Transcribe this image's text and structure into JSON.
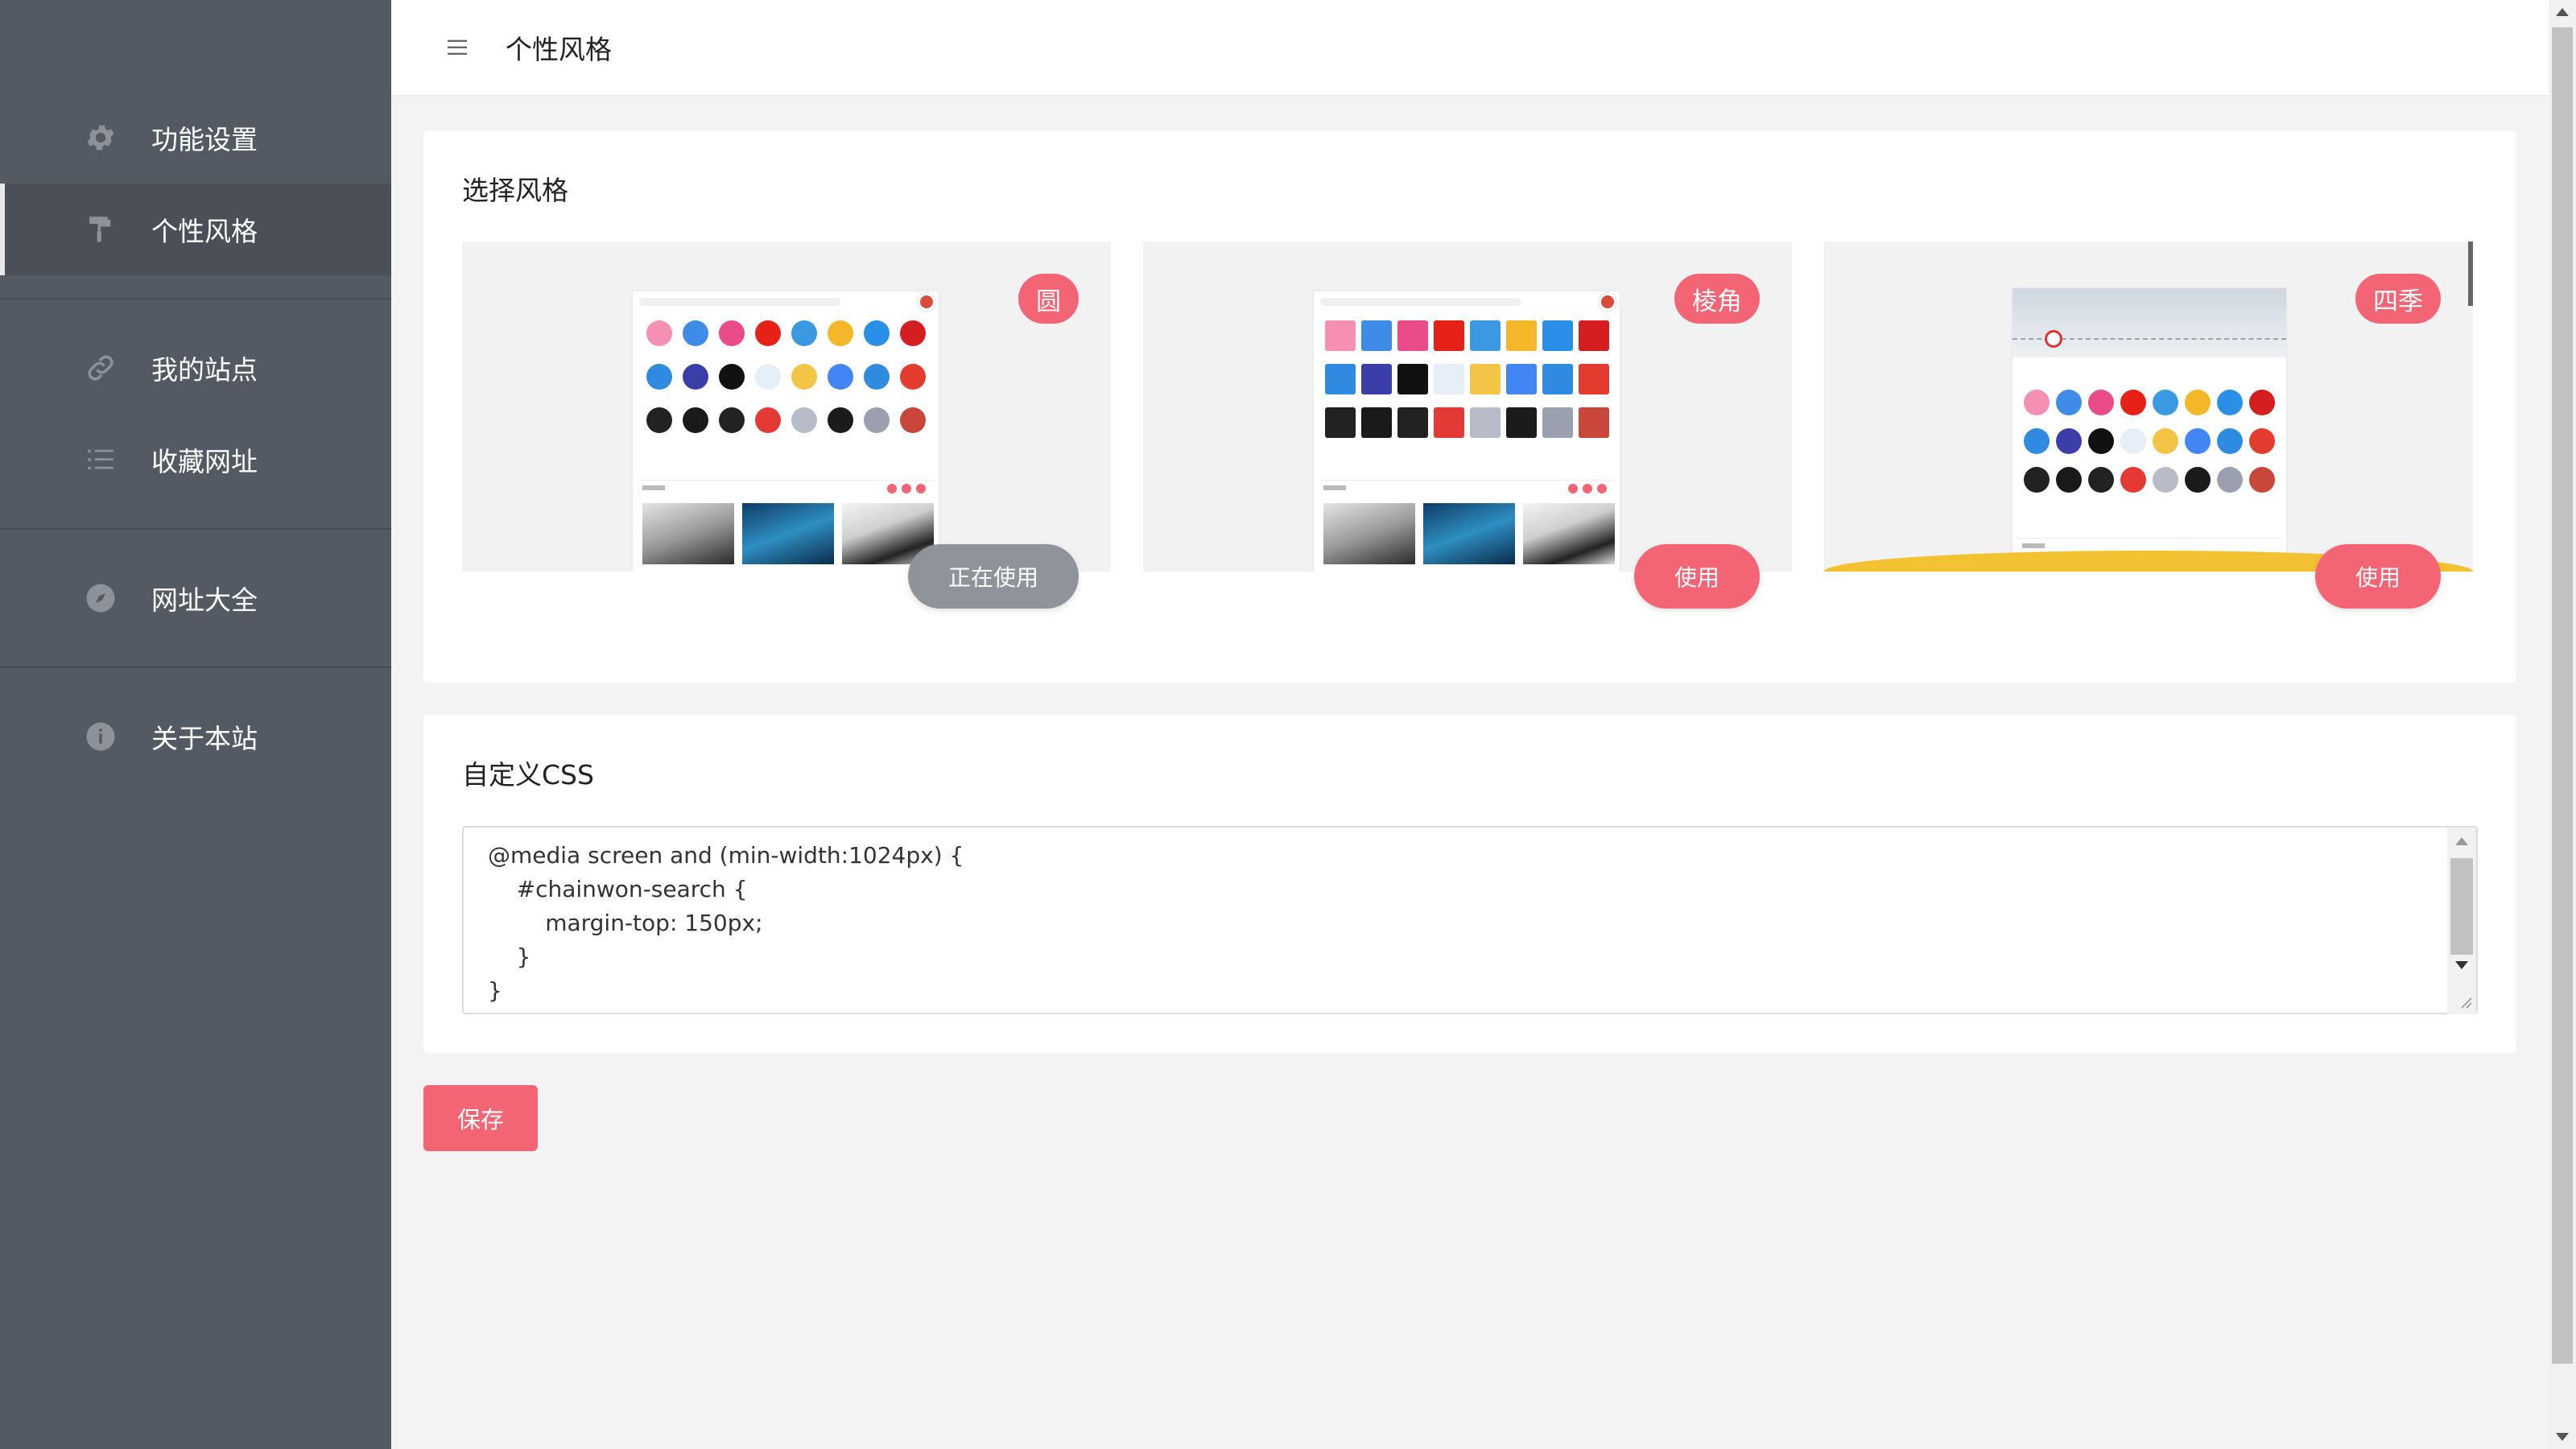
{
  "sidebar": {
    "items": [
      {
        "label": "功能设置",
        "icon": "gear-icon"
      },
      {
        "label": "个性风格",
        "icon": "paint-roller-icon",
        "active": true
      },
      {
        "label": "我的站点",
        "icon": "link-icon"
      },
      {
        "label": "收藏网址",
        "icon": "list-icon"
      },
      {
        "label": "网址大全",
        "icon": "compass-icon"
      },
      {
        "label": "关于本站",
        "icon": "info-icon"
      }
    ]
  },
  "header": {
    "title": "个性风格",
    "menu_icon": "hamburger-icon"
  },
  "style_section": {
    "title": "选择风格",
    "themes": [
      {
        "badge": "圆",
        "button": "正在使用",
        "in_use": true
      },
      {
        "badge": "棱角",
        "button": "使用",
        "in_use": false
      },
      {
        "badge": "四季",
        "button": "使用",
        "in_use": false
      }
    ]
  },
  "css_section": {
    "title": "自定义CSS",
    "code": "@media screen and (min-width:1024px) {\n    #chainwon-search {\n        margin-top: 150px;\n    }\n}"
  },
  "save_label": "保存",
  "colors": {
    "sidebar_bg": "#545a63",
    "accent": "#f36575",
    "in_use_button": "#8f949b"
  }
}
